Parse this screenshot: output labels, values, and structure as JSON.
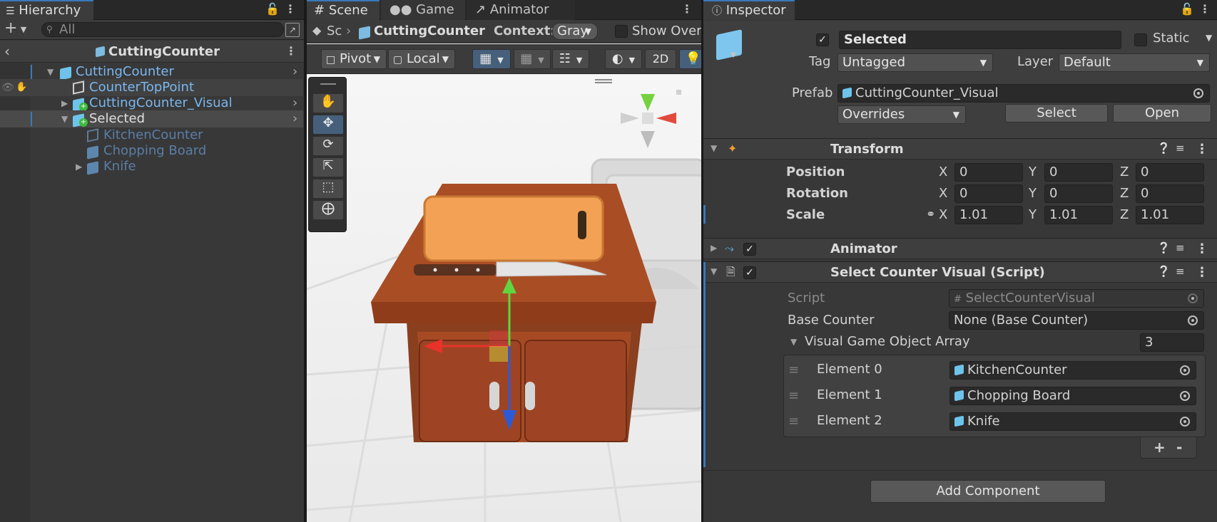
{
  "hierarchy": {
    "tab_label": "Hierarchy",
    "search_placeholder": "All",
    "breadcrumb_title": "CuttingCounter",
    "rows": [
      {
        "label": "CuttingCounter",
        "color": "#7bb7ef"
      },
      {
        "label": "CounterTopPoint",
        "color": "#7bb7ef"
      },
      {
        "label": "CuttingCounter_Visual",
        "color": "#7bb7ef"
      },
      {
        "label": "Selected",
        "color": "#d6d6d6"
      },
      {
        "label": "KitchenCounter",
        "color": "#5a7ea6"
      },
      {
        "label": "Chopping Board",
        "color": "#5a7ea6"
      },
      {
        "label": "Knife",
        "color": "#5a7ea6"
      }
    ]
  },
  "scene": {
    "tabs": [
      {
        "label": "Scene",
        "icon": "grid-icon"
      },
      {
        "label": "Game",
        "icon": "gamepad-icon"
      },
      {
        "label": "Animator",
        "icon": "animator-icon"
      }
    ],
    "breadcrumb_root": "Sc",
    "breadcrumb_current": "CuttingCounter",
    "context_label": "Context:",
    "context_value": "Gray",
    "show_overrides_label": "Show Overri",
    "pivot_label": "Pivot",
    "local_label": "Local",
    "mode_2d": "2D"
  },
  "inspector": {
    "tab_label": "Inspector",
    "object_name": "Selected",
    "static_label": "Static",
    "tag_label": "Tag",
    "tag_value": "Untagged",
    "layer_label": "Layer",
    "layer_value": "Default",
    "prefab_label": "Prefab",
    "prefab_value": "CuttingCounter_Visual",
    "overrides_label": "Overrides",
    "select_label": "Select",
    "open_label": "Open",
    "transform": {
      "title": "Transform",
      "position_label": "Position",
      "rotation_label": "Rotation",
      "scale_label": "Scale",
      "axis_x": "X",
      "axis_y": "Y",
      "axis_z": "Z",
      "position": [
        "0",
        "0",
        "0"
      ],
      "rotation": [
        "0",
        "0",
        "0"
      ],
      "scale": [
        "1.01",
        "1.01",
        "1.01"
      ]
    },
    "animator_title": "Animator",
    "script_component": {
      "title": "Select Counter Visual (Script)",
      "script_label": "Script",
      "script_value": "SelectCounterVisual",
      "base_counter_label": "Base Counter",
      "base_counter_value": "None (Base Counter)",
      "array_label": "Visual Game Object Array",
      "array_size": "3",
      "elements": [
        {
          "label": "Element 0",
          "value": "KitchenCounter"
        },
        {
          "label": "Element 1",
          "value": "Chopping Board"
        },
        {
          "label": "Element 2",
          "value": "Knife"
        }
      ],
      "add_symbol": "+",
      "remove_symbol": "-"
    },
    "add_component_label": "Add Component"
  }
}
